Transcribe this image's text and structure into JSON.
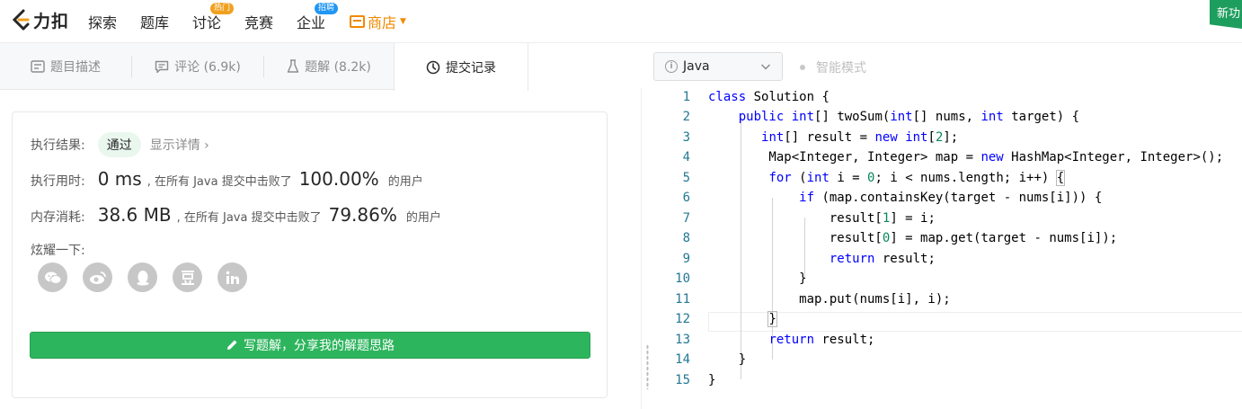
{
  "nav": {
    "logo_text": "力扣",
    "items": [
      {
        "label": "探索"
      },
      {
        "label": "题库"
      },
      {
        "label": "讨论",
        "badge": "热门"
      },
      {
        "label": "竞赛"
      },
      {
        "label": "企业",
        "badge": "招聘"
      }
    ],
    "shop_label": "商店",
    "new_feature_label": "新功"
  },
  "tabs": [
    {
      "label": "题目描述",
      "icon": "description-icon"
    },
    {
      "label": "评论 (6.9k)",
      "icon": "comment-icon"
    },
    {
      "label": "题解 (8.2k)",
      "icon": "flask-icon"
    },
    {
      "label": "提交记录",
      "icon": "clock-icon",
      "active": true
    }
  ],
  "result": {
    "status_label": "执行结果:",
    "status_value": "通过",
    "detail_link": "显示详情 ›",
    "runtime_label": "执行用时:",
    "runtime_value": "0 ms",
    "runtime_text": ", 在所有 Java 提交中击败了",
    "runtime_percent": "100.00%",
    "runtime_suffix": "的用户",
    "memory_label": "内存消耗:",
    "memory_value": "38.6 MB",
    "memory_text": ", 在所有 Java 提交中击败了",
    "memory_percent": "79.86%",
    "memory_suffix": "的用户",
    "share_label": "炫耀一下:",
    "share_icons": [
      "wechat-icon",
      "weibo-icon",
      "qq-icon",
      "douban-icon",
      "linkedin-icon"
    ],
    "write_button": "写题解，分享我的解题思路"
  },
  "editor": {
    "language": "Java",
    "smart_mode": "智能模式",
    "line_numbers": [
      "1",
      "2",
      "3",
      "4",
      "5",
      "6",
      "7",
      "8",
      "9",
      "10",
      "11",
      "12",
      "13",
      "14",
      "15"
    ]
  },
  "colors": {
    "accent_green": "#2db55d",
    "shop_orange": "#f08a00",
    "keyword_blue": "#0000ff",
    "number_green": "#098658",
    "line_number": "#237893"
  }
}
